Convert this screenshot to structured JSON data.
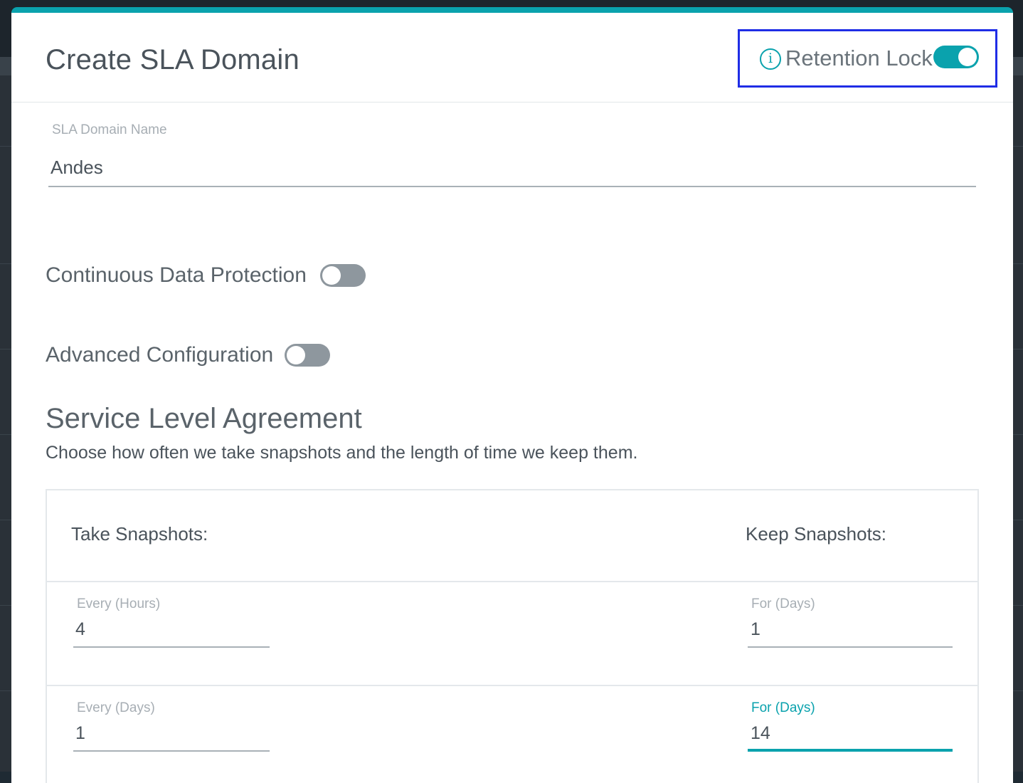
{
  "modal": {
    "title": "Create SLA Domain",
    "accent_color": "#0aa2ad",
    "retention_lock": {
      "label": "Retention Lock",
      "info_icon": "info-icon",
      "info_glyph": "i",
      "enabled": true
    }
  },
  "sla_domain_name": {
    "label": "SLA Domain Name",
    "value": "Andes"
  },
  "continuous_data_protection": {
    "label": "Continuous Data Protection",
    "enabled": false
  },
  "advanced_configuration": {
    "label": "Advanced Configuration",
    "enabled": false
  },
  "service_level_agreement": {
    "title": "Service Level Agreement",
    "description": "Choose how often we take snapshots and the length of time we keep them.",
    "take_header": "Take Snapshots:",
    "keep_header": "Keep Snapshots:",
    "rows": [
      {
        "take_label": "Every (Hours)",
        "take_value": "4",
        "keep_label": "For (Days)",
        "keep_value": "1"
      },
      {
        "take_label": "Every (Days)",
        "take_value": "1",
        "keep_label": "For (Days)",
        "keep_value": "14"
      }
    ]
  }
}
